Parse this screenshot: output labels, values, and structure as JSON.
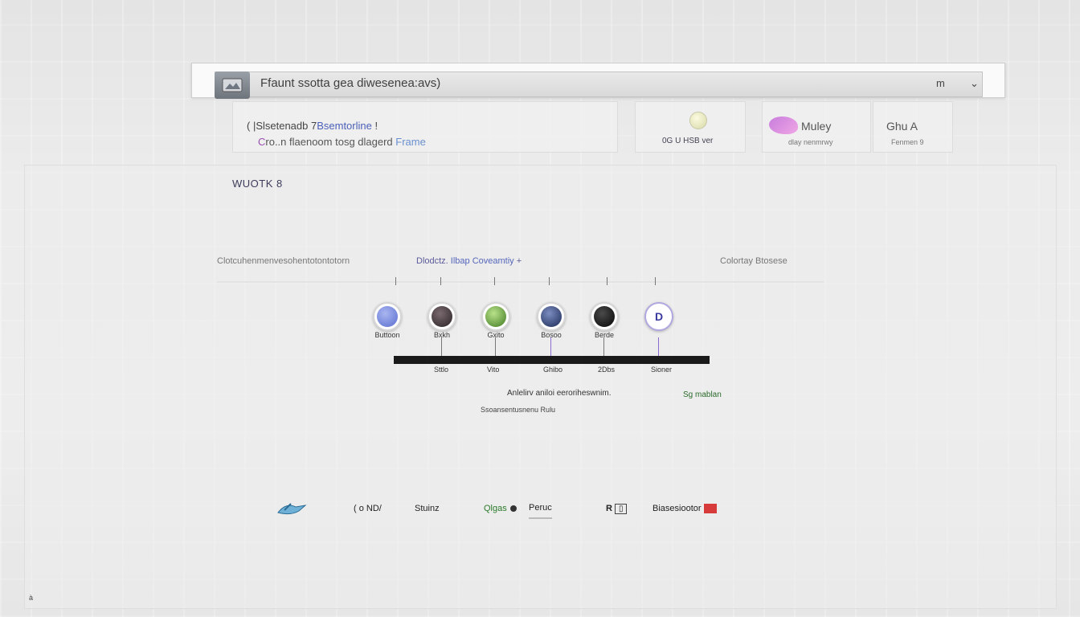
{
  "topbar": {
    "title": "Ffaunt ssotta gea diwesenea:avs)",
    "ctrl_left": "m",
    "ctrl_right": "⌄"
  },
  "search_card": {
    "line1_prefix": "( |Slsetenadb 7",
    "line1_highlight": "Bsemtorline",
    "line1_suffix": " !",
    "line2_mark": "C",
    "line2_text": "ro..n flaenoom tosg dlagerd",
    "line2_accent": " Frame"
  },
  "status_card": {
    "text": "0G   U  HSB  ver"
  },
  "user_card": {
    "name": "Muley",
    "sub": "dlay nenmrwy"
  },
  "meta_card": {
    "title": "Ghu A",
    "sub": "Fenmen  9"
  },
  "section": {
    "title": "WUOTK 8"
  },
  "rows": {
    "left": "Clotcuhenmenvesohentotontotorn",
    "mid_prefix": "Dlodctz. ",
    "mid_highlight": "Ilbap Coveamtiy",
    "mid_suffix": "  +",
    "right": "Colortay Btosese"
  },
  "nodes": [
    {
      "label": "Buttoon",
      "color": "#6c7fd6",
      "stem": "none"
    },
    {
      "label": "Bxkh",
      "color": "#3a3235",
      "stem": "dark"
    },
    {
      "label": "Gxito",
      "color": "#5aa036",
      "stem": "dark"
    },
    {
      "label": "Bosoo",
      "color": "#2b3a6b",
      "stem": "purple"
    },
    {
      "label": "Berde",
      "color": "#0e0e0e",
      "stem": "dark"
    },
    {
      "label": "",
      "color": "#ffffff",
      "stem": "purple"
    }
  ],
  "timeline": {
    "labels": [
      "Sttlo",
      "Vito",
      "Ghibo",
      "2Dbs",
      "Sioner"
    ]
  },
  "notes": {
    "note1": "Anlelirv aniloi eeroriheswnim.",
    "note2": "Sg mablan",
    "note3": "Ssoansentusnenu Rulu"
  },
  "logos": [
    "",
    "( o ND/",
    "Stuinz",
    "Qlgas",
    "Peruc",
    "R",
    "Biasesiootor"
  ],
  "footer": {
    "corner": "à"
  }
}
